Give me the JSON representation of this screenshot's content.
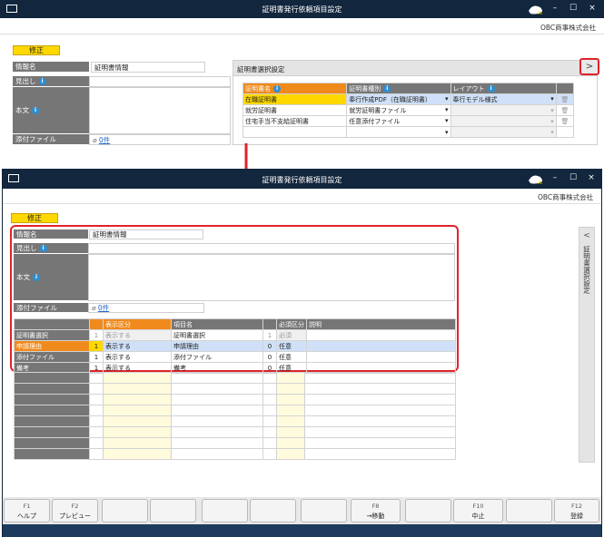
{
  "top_window": {
    "title": "証明書発行依頼項目設定",
    "company": "OBC商事株式会社",
    "modify_badge": "修正",
    "info_name_label": "情報名",
    "info_name_value": "証明書情報",
    "heading_label": "見出し",
    "body_label": "本文",
    "attach_label": "添付ファイル",
    "attach_value": "0件",
    "panel_title": "証明書選択設定",
    "expand_button": ">",
    "panel_headers": [
      "証明書名",
      "証明書種別",
      "レイアウト"
    ],
    "panel_rows": [
      {
        "name": "在職証明書",
        "type": "奉行作成PDF（在職証明書）",
        "layout": "奉行モデル様式"
      },
      {
        "name": "就労証明書",
        "type": "就労証明書ファイル",
        "layout": ""
      },
      {
        "name": "住宅手当不支給証明書",
        "type": "任意添付ファイル",
        "layout": ""
      },
      {
        "name": "",
        "type": "",
        "layout": ""
      }
    ]
  },
  "bottom_window": {
    "title": "証明書発行依頼項目設定",
    "company": "OBC商事株式会社",
    "modify_badge": "修正",
    "info_name_label": "情報名",
    "info_name_value": "証明書情報",
    "heading_label": "見出し",
    "body_label": "本文",
    "attach_label": "添付ファイル",
    "attach_value": "0件",
    "side_tab_label": "証明書選択設定",
    "side_tab_chevron": "<",
    "table_headers": {
      "display": "表示区分",
      "item": "項目名",
      "required": "必須区分",
      "desc": "説明"
    },
    "table_rows": [
      {
        "label": "証明書選択",
        "num": "1",
        "display": "表示する",
        "item": "証明書選択",
        "rnum": "1",
        "required": "必須"
      },
      {
        "label": "申請理由",
        "num": "1",
        "display": "表示する",
        "item": "申請理由",
        "rnum": "0",
        "required": "任意"
      },
      {
        "label": "添付ファイル",
        "num": "1",
        "display": "表示する",
        "item": "添付ファイル",
        "rnum": "0",
        "required": "任意"
      },
      {
        "label": "備考",
        "num": "1",
        "display": "表示する",
        "item": "備考",
        "rnum": "0",
        "required": "任意"
      }
    ],
    "fkeys": [
      {
        "key": "F1",
        "label": "ヘルプ"
      },
      {
        "key": "F2",
        "label": "プレビュー"
      },
      {
        "key": "",
        "label": ""
      },
      {
        "key": "",
        "label": ""
      },
      {
        "key": "",
        "label": ""
      },
      {
        "key": "",
        "label": ""
      },
      {
        "key": "",
        "label": ""
      },
      {
        "key": "F8",
        "label": "→移動"
      },
      {
        "key": "",
        "label": ""
      },
      {
        "key": "F10",
        "label": "中止"
      },
      {
        "key": "",
        "label": ""
      },
      {
        "key": "F12",
        "label": "登録"
      }
    ]
  },
  "colors": {
    "titlebar": "#12263d",
    "highlight_red": "#e0232b",
    "orange_header": "#f08a1c",
    "yellow_badge": "#ffd800",
    "selected_row": "#cfe0f8"
  }
}
